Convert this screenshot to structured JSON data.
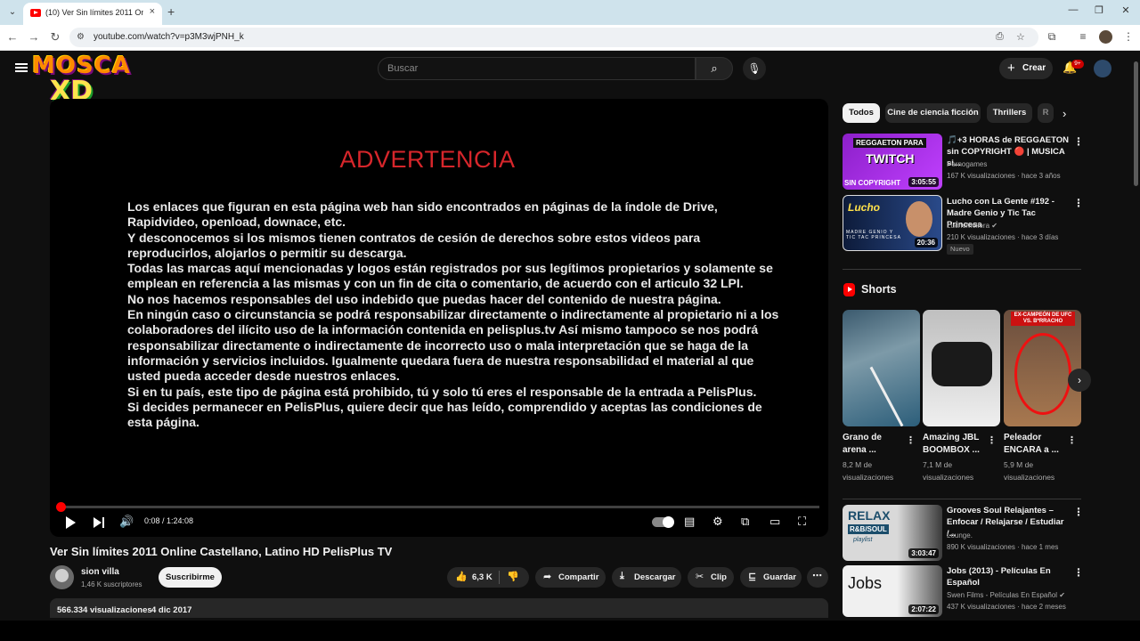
{
  "browser": {
    "tab_title": "(10) Ver Sin límites 2011 Online",
    "url": "youtube.com/watch?v=p3M3wjPNH_k",
    "new_tab_icon": "plus-icon"
  },
  "header": {
    "logo_line1": "MOSCA",
    "logo_line2": "XD",
    "search_placeholder": "Buscar",
    "create_label": "Crear",
    "notifications_badge": "9+"
  },
  "player": {
    "warning_title": "ADVERTENCIA",
    "warning_paragraphs": [
      "Los enlaces que figuran en esta página web han sido encontrados en páginas de la índole de Drive, Rapidvideo, openload, downace, etc.",
      "Y desconocemos si los mismos tienen contratos de cesión de derechos sobre estos videos para reproducirlos, alojarlos o permitir su descarga.",
      "Todas las marcas aquí mencionadas y logos están registrados por sus legítimos propietarios y solamente se emplean en referencia a las mismas y con un fin de cita o comentario, de acuerdo con el articulo 32 LPI.",
      "No nos hacemos responsables del uso indebido que puedas hacer del contenido de nuestra página.",
      "En ningún caso o circunstancia se podrá responsabilizar directamente o indirectamente al propietario ni a los colaboradores del ilícito uso de la información contenida en pelisplus.tv Así mismo tampoco se nos podrá responsabilizar directamente o indirectamente de incorrecto uso o mala interpretación que se haga de la información y servicios incluidos. Igualmente quedara fuera de nuestra responsabilidad el material al que usted pueda acceder desde nuestros enlaces.",
      "Si en tu país, este tipo de página está prohibido, tú y solo tú eres el responsable de la entrada a PelisPlus.",
      "Si decides permanecer en PelisPlus, quiere decir que has leído, comprendido y aceptas las condiciones de esta página."
    ],
    "time_display": "0:08 / 1:24:08",
    "progress_fraction": 0.0016
  },
  "video": {
    "title": "Ver Sin límites 2011 Online Castellano, Latino HD PelisPlus TV",
    "channel_name": "sion villa",
    "subscribers": "1,46 K suscriptores",
    "subscribe_label": "Suscribirme",
    "likes": "6,3 K",
    "share_label": "Compartir",
    "download_label": "Descargar",
    "clip_label": "Clip",
    "save_label": "Guardar",
    "views": "566.334 visualizaciones",
    "date": "4 dic 2017"
  },
  "sidebar": {
    "chips": [
      "Todos",
      "Cine de ciencia ficción",
      "Thrillers",
      "R"
    ],
    "recommendations": [
      {
        "title": "🎵+3 HORAS de REGGAETON sin COPYRIGHT 🔴 | MUSICA si...",
        "channel": "Pernogames",
        "meta": "167 K visualizaciones · hace 3 años",
        "duration": "3:05:55",
        "thumb_text1": "REGGAETON PARA",
        "thumb_text2": "TWITCH",
        "thumb_text3": "SIN COPYRIGHT",
        "verified": false
      },
      {
        "title": "Lucho con La Gente #192 - Madre Genio y Tic Tac Princesa",
        "channel": "LuchoMellera",
        "meta": "210 K visualizaciones · hace 3 días",
        "duration": "20:36",
        "badge": "Nuevo",
        "thumb_text1": "Lucho",
        "thumb_text2": "MADRE GENIO Y TIC TAC PRINCESA",
        "verified": true
      },
      {
        "title": "Grooves Soul Relajantes – Enfocar / Relajarse / Estudiar /...",
        "channel": "Lounge.",
        "meta": "890 K visualizaciones · hace 1 mes",
        "duration": "3:03:47",
        "thumb_text1": "RELAX",
        "thumb_text2": "R&B/SOUL",
        "thumb_text3": "playlist",
        "verified": false
      },
      {
        "title": "Jobs (2013) - Películas En Español",
        "channel": "Swen Films - Películas En Español",
        "meta": "437 K visualizaciones · hace 2 meses",
        "duration": "2:07:22",
        "thumb_text1": "Jobs",
        "verified": true
      }
    ],
    "shorts_label": "Shorts",
    "shorts": [
      {
        "title": "Grano de arena ...",
        "views": "8,2 M de visualizaciones"
      },
      {
        "title": "Amazing JBL BOOMBOX ...",
        "views": "7,1 M de visualizaciones"
      },
      {
        "title": "Peleador ENCARA a ...",
        "views": "5,9 M de visualizaciones",
        "thumb_text": "EX-CAMPEÓN DE UFC VS. B*RRACHO"
      }
    ]
  },
  "colors": {
    "accent": "#ff0000",
    "bg": "#0f0f0f",
    "warning_red": "#d7262b"
  }
}
